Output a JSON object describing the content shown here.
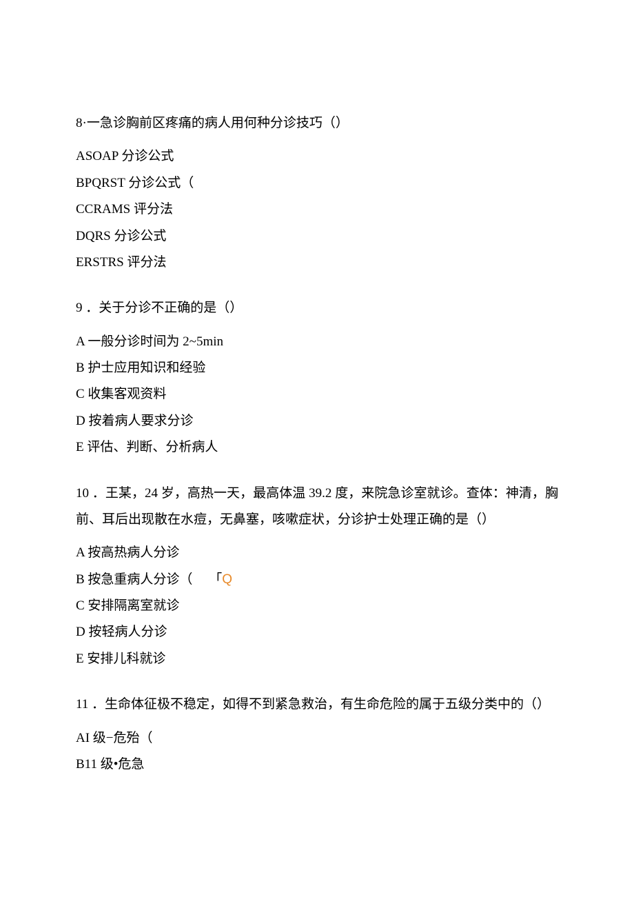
{
  "q8": {
    "stem": "8·一急诊胸前区疼痛的病人用何种分诊技巧（）",
    "A": "ASOAP 分诊公式",
    "B": "BPQRST 分诊公式（",
    "C": "CCRAMS 评分法",
    "D": "DQRS 分诊公式",
    "E": "ERSTRS 评分法"
  },
  "q9": {
    "stem": "9 ．关于分诊不正确的是（）",
    "A": "A 一般分诊时间为 2~5min",
    "B": "B 护士应用知识和经验",
    "C": "C 收集客观资料",
    "D": "D 按着病人要求分诊",
    "E": "E 评估、判断、分析病人"
  },
  "q10": {
    "stem": "10 ．王某，24 岁，高热一天，最高体温 39.2 度，来院急诊室就诊。查体：神清，胸前、耳后出现散在水痘，无鼻塞，咳嗽症状，分诊护士处理正确的是（）",
    "A": "A 按高热病人分诊",
    "B_pre": "B 按急重病人分诊（",
    "B_bracket": "「",
    "B_Q": "Q",
    "C": "C 安排隔离室就诊",
    "D": "D 按轻病人分诊",
    "E": "E 安排儿科就诊"
  },
  "q11": {
    "stem": "11 ．生命体征极不稳定，如得不到紧急救治，有生命危险的属于五级分类中的（）",
    "A": "AI 级−危殆（",
    "B": "B11 级•危急"
  }
}
